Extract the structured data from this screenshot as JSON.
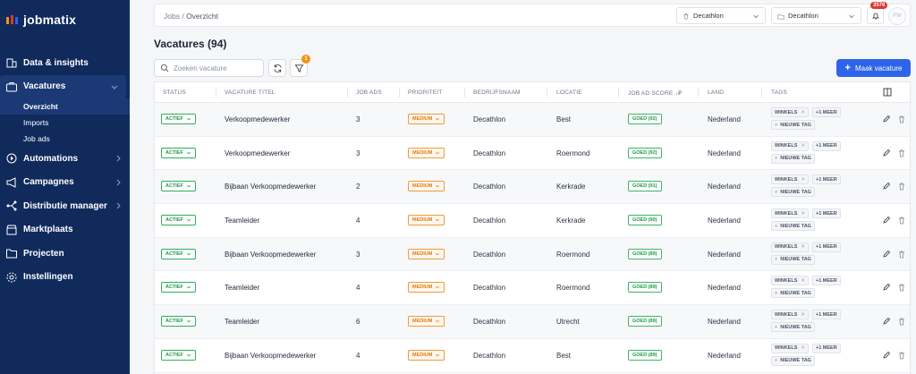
{
  "app": {
    "name": "jobmatix",
    "logo_colors": [
      "#f39312",
      "#e0362f",
      "#2d64e8",
      "#2eaf59"
    ]
  },
  "sidebar": {
    "items": [
      {
        "label": "Data & insights",
        "icon": "building-icon"
      },
      {
        "label": "Vacatures",
        "icon": "briefcase-icon",
        "active": true,
        "sub": [
          {
            "label": "Overzicht",
            "active": true
          },
          {
            "label": "Imports"
          },
          {
            "label": "Job ads"
          }
        ]
      },
      {
        "label": "Automations",
        "icon": "automation-icon"
      },
      {
        "label": "Campagnes",
        "icon": "megaphone-icon"
      },
      {
        "label": "Distributie manager",
        "icon": "share-icon"
      },
      {
        "label": "Marktplaats",
        "icon": "store-icon"
      },
      {
        "label": "Projecten",
        "icon": "folder-icon"
      },
      {
        "label": "Instellingen",
        "icon": "gear-icon"
      }
    ]
  },
  "topbar": {
    "breadcrumb": [
      "Jobs",
      "Overzicht"
    ],
    "select1": "Decathlon",
    "select2": "Decathlon",
    "notifications": "3576",
    "avatar": "PW"
  },
  "page": {
    "title": "Vacatures (94)",
    "search_placeholder": "Zoeken vacature",
    "filter_count": "1",
    "create_label": "Maak vacature"
  },
  "columns": [
    "STATUS",
    "VACATURE TITEL",
    "JOB ADS",
    "PRIORITEIT",
    "BEDRIJFSNAAM",
    "LOCATIE",
    "JOB AD SCORE ↓₽",
    "LAND",
    "TAGS"
  ],
  "tag_labels": {
    "tag": "WINKELS",
    "more": "+1 MEER",
    "new": "NIEUWE TAG"
  },
  "rows": [
    {
      "status": "ACTIEF",
      "title": "Verkoopmedewerker",
      "job_ads": "3",
      "priority": "MEDIUM",
      "company": "Decathlon",
      "location": "Best",
      "score": "GOED (92)",
      "country": "Nederland"
    },
    {
      "status": "ACTIEF",
      "title": "Verkoopmedewerker",
      "job_ads": "3",
      "priority": "MEDIUM",
      "company": "Decathlon",
      "location": "Roermond",
      "score": "GOED (92)",
      "country": "Nederland"
    },
    {
      "status": "ACTIEF",
      "title": "Bijbaan Verkoopmedewerker",
      "job_ads": "2",
      "priority": "MEDIUM",
      "company": "Decathlon",
      "location": "Kerkrade",
      "score": "GOED (91)",
      "country": "Nederland"
    },
    {
      "status": "ACTIEF",
      "title": "Teamleider",
      "job_ads": "4",
      "priority": "MEDIUM",
      "company": "Decathlon",
      "location": "Kerkrade",
      "score": "GOED (90)",
      "country": "Nederland"
    },
    {
      "status": "ACTIEF",
      "title": "Bijbaan Verkoopmedewerker",
      "job_ads": "3",
      "priority": "MEDIUM",
      "company": "Decathlon",
      "location": "Roermond",
      "score": "GOED (89)",
      "country": "Nederland"
    },
    {
      "status": "ACTIEF",
      "title": "Teamleider",
      "job_ads": "4",
      "priority": "MEDIUM",
      "company": "Decathlon",
      "location": "Roermond",
      "score": "GOED (89)",
      "country": "Nederland"
    },
    {
      "status": "ACTIEF",
      "title": "Teamleider",
      "job_ads": "6",
      "priority": "MEDIUM",
      "company": "Decathlon",
      "location": "Utrecht",
      "score": "GOED (89)",
      "country": "Nederland"
    },
    {
      "status": "ACTIEF",
      "title": "Bijbaan Verkoopmedewerker",
      "job_ads": "4",
      "priority": "MEDIUM",
      "company": "Decathlon",
      "location": "Best",
      "score": "GOED (89)",
      "country": "Nederland"
    }
  ]
}
